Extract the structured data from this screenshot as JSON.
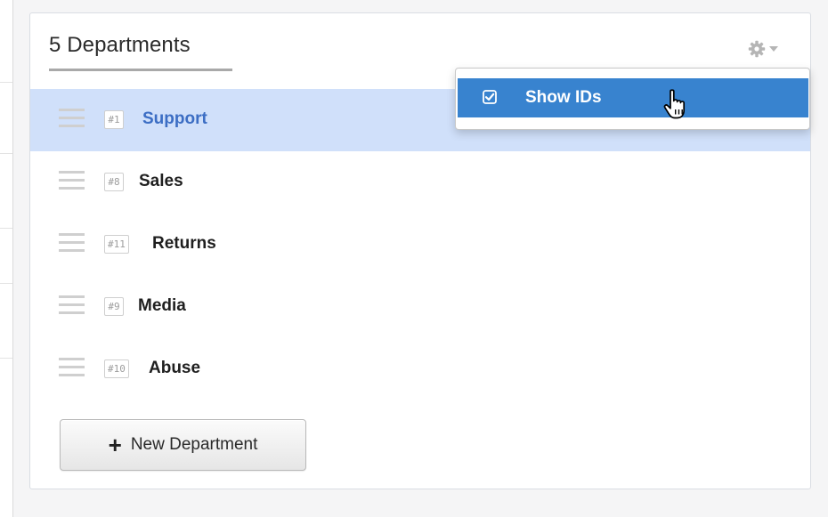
{
  "panel": {
    "title": "5 Departments"
  },
  "settings": {
    "icon": "gear-icon",
    "menu": {
      "items": [
        {
          "label": "Show IDs",
          "checked": true
        }
      ]
    }
  },
  "departments": [
    {
      "id_label": "#1",
      "name": "Support",
      "selected": true
    },
    {
      "id_label": "#8",
      "name": "Sales",
      "selected": false
    },
    {
      "id_label": "#11",
      "name": "Returns",
      "selected": false
    },
    {
      "id_label": "#9",
      "name": "Media",
      "selected": false
    },
    {
      "id_label": "#10",
      "name": "Abuse",
      "selected": false
    }
  ],
  "actions": {
    "new_department_label": "New Department"
  },
  "colors": {
    "selected_row_bg": "#d0e0fa",
    "selected_text": "#3c6ec4",
    "menu_highlight": "#3883cf"
  }
}
